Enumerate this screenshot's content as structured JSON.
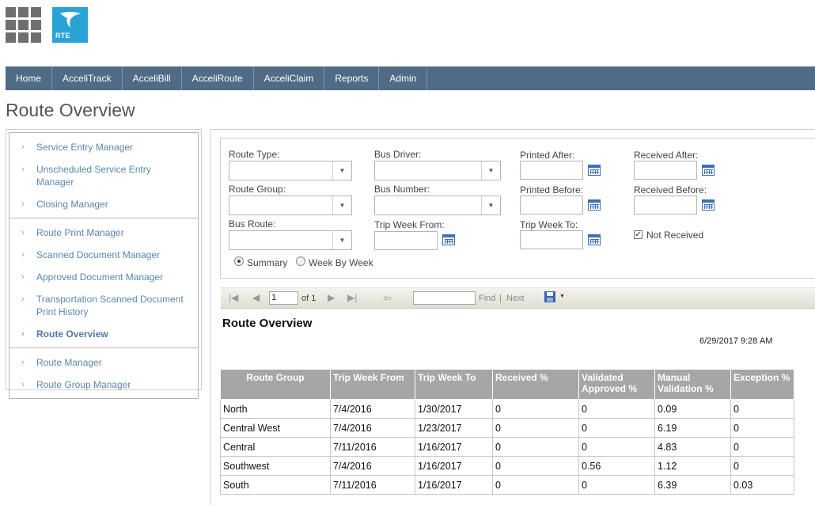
{
  "header": {
    "apps_icon": "grid-icon",
    "logo_text": "RTE",
    "brand_color": "#29a3d6"
  },
  "nav": {
    "items": [
      "Home",
      "AcceliTrack",
      "AcceliBill",
      "AcceliRoute",
      "AcceliClaim",
      "Reports",
      "Admin"
    ],
    "bar_color": "#4f6b85"
  },
  "page": {
    "title": "Route Overview"
  },
  "sidebar": {
    "groups": [
      [
        "Service Entry Manager",
        "Unscheduled Service Entry Manager",
        "Closing Manager"
      ],
      [
        "Route Print Manager",
        "Scanned Document Manager",
        "Approved Document Manager",
        "Transportation Scanned Document Print History",
        "Route Overview"
      ],
      [
        "Route Manager",
        "Route Group Manager"
      ]
    ],
    "active": "Route Overview"
  },
  "filters": {
    "route_type": {
      "label": "Route Type:",
      "value": ""
    },
    "route_group": {
      "label": "Route Group:",
      "value": ""
    },
    "bus_route": {
      "label": "Bus Route:",
      "value": ""
    },
    "bus_driver": {
      "label": "Bus Driver:",
      "value": ""
    },
    "bus_number": {
      "label": "Bus Number:",
      "value": ""
    },
    "trip_week_from": {
      "label": "Trip Week From:",
      "value": ""
    },
    "printed_after": {
      "label": "Printed After:",
      "value": ""
    },
    "printed_before": {
      "label": "Printed Before:",
      "value": ""
    },
    "trip_week_to": {
      "label": "Trip Week To:",
      "value": ""
    },
    "received_after": {
      "label": "Received After:",
      "value": ""
    },
    "received_before": {
      "label": "Received Before:",
      "value": ""
    },
    "not_received": {
      "label": "Not Received",
      "checked": true
    },
    "view_mode": {
      "options": [
        "Summary",
        "Week By Week"
      ],
      "selected": "Summary"
    }
  },
  "toolbar": {
    "page_value": "1",
    "of_text": "of 1",
    "find_value": "",
    "find_label": "Find",
    "separator": "|",
    "next_label": "Next",
    "export_icon": "save-disk-icon"
  },
  "report": {
    "title": "Route Overview",
    "timestamp": "6/29/2017 9:28 AM",
    "columns": [
      "Route Group",
      "Trip Week From",
      "Trip Week To",
      "Received %",
      "Validated Approved %",
      "Manual Validation %",
      "Exception %"
    ],
    "rows": [
      [
        "North",
        "7/4/2016",
        "1/30/2017",
        "0",
        "0",
        "0.09",
        "0"
      ],
      [
        "Central West",
        "7/4/2016",
        "1/23/2017",
        "0",
        "0",
        "6.19",
        "0"
      ],
      [
        "Central",
        "7/11/2016",
        "1/16/2017",
        "0",
        "0",
        "4.83",
        "0"
      ],
      [
        "Southwest",
        "7/4/2016",
        "1/16/2017",
        "0",
        "0.56",
        "1.12",
        "0"
      ],
      [
        "South",
        "7/11/2016",
        "1/16/2017",
        "0",
        "0",
        "6.39",
        "0.03"
      ]
    ]
  }
}
